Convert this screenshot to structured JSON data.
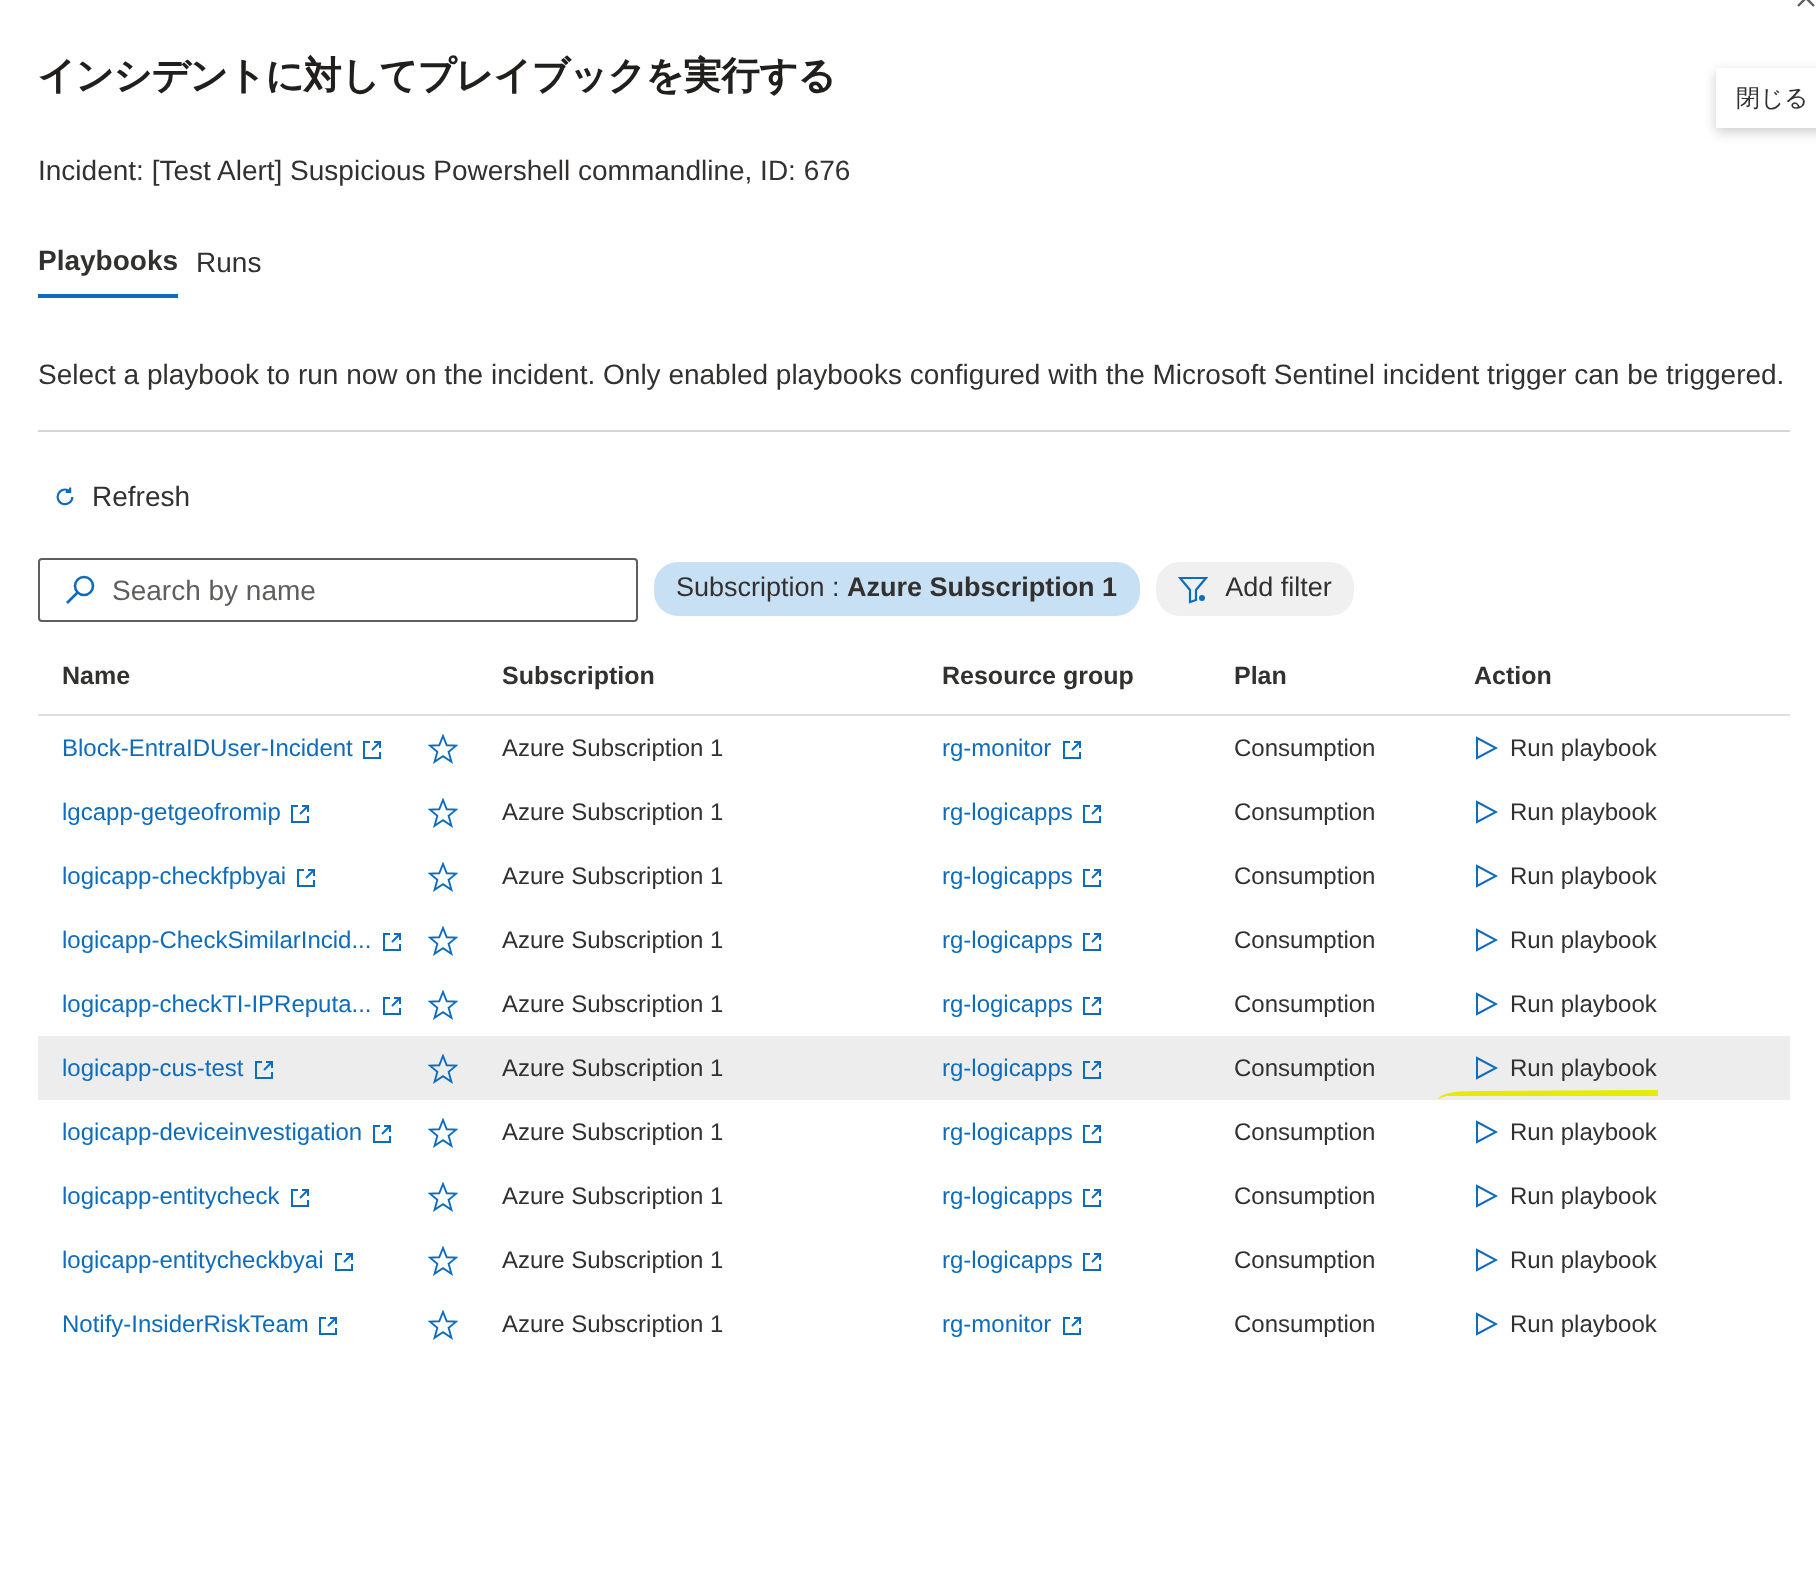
{
  "title": "インシデントに対してプレイブックを実行する",
  "close_tooltip": "閉じる",
  "incident": "Incident: [Test Alert] Suspicious Powershell commandline, ID: 676",
  "tabs": [
    {
      "label": "Playbooks",
      "selected": true
    },
    {
      "label": "Runs",
      "selected": false
    }
  ],
  "description": "Select a playbook to run now on the incident. Only enabled playbooks configured with the Microsoft Sentinel incident trigger can be triggered.",
  "refresh": "Refresh",
  "search": {
    "placeholder": "Search by name"
  },
  "filter_chip": {
    "label": "Subscription : ",
    "value": "Azure Subscription 1"
  },
  "add_filter": "Add filter",
  "table": {
    "columns": [
      "Name",
      "Subscription",
      "Resource group",
      "Plan",
      "Action"
    ],
    "rows": [
      {
        "name": "Block-EntraIDUser-Incident",
        "favorite": false,
        "subscription": "Azure Subscription 1",
        "resource_group": "rg-monitor",
        "plan": "Consumption",
        "action": "Run playbook",
        "selected": false,
        "highlighted": false
      },
      {
        "name": "lgcapp-getgeofromip",
        "favorite": false,
        "subscription": "Azure Subscription 1",
        "resource_group": "rg-logicapps",
        "plan": "Consumption",
        "action": "Run playbook",
        "selected": false,
        "highlighted": false
      },
      {
        "name": "logicapp-checkfpbyai",
        "favorite": false,
        "subscription": "Azure Subscription 1",
        "resource_group": "rg-logicapps",
        "plan": "Consumption",
        "action": "Run playbook",
        "selected": false,
        "highlighted": false
      },
      {
        "name": "logicapp-CheckSimilarIncid...",
        "favorite": false,
        "subscription": "Azure Subscription 1",
        "resource_group": "rg-logicapps",
        "plan": "Consumption",
        "action": "Run playbook",
        "selected": false,
        "highlighted": false
      },
      {
        "name": "logicapp-checkTI-IPReputa...",
        "favorite": false,
        "subscription": "Azure Subscription 1",
        "resource_group": "rg-logicapps",
        "plan": "Consumption",
        "action": "Run playbook",
        "selected": false,
        "highlighted": false
      },
      {
        "name": "logicapp-cus-test",
        "favorite": false,
        "subscription": "Azure Subscription 1",
        "resource_group": "rg-logicapps",
        "plan": "Consumption",
        "action": "Run playbook",
        "selected": true,
        "highlighted": true
      },
      {
        "name": "logicapp-deviceinvestigation",
        "favorite": false,
        "subscription": "Azure Subscription 1",
        "resource_group": "rg-logicapps",
        "plan": "Consumption",
        "action": "Run playbook",
        "selected": false,
        "highlighted": false
      },
      {
        "name": "logicapp-entitycheck",
        "favorite": false,
        "subscription": "Azure Subscription 1",
        "resource_group": "rg-logicapps",
        "plan": "Consumption",
        "action": "Run playbook",
        "selected": false,
        "highlighted": false
      },
      {
        "name": "logicapp-entitycheckbyai",
        "favorite": false,
        "subscription": "Azure Subscription 1",
        "resource_group": "rg-logicapps",
        "plan": "Consumption",
        "action": "Run playbook",
        "selected": false,
        "highlighted": false
      },
      {
        "name": "Notify-InsiderRiskTeam",
        "favorite": false,
        "subscription": "Azure Subscription 1",
        "resource_group": "rg-monitor",
        "plan": "Consumption",
        "action": "Run playbook",
        "selected": false,
        "highlighted": false
      }
    ]
  }
}
